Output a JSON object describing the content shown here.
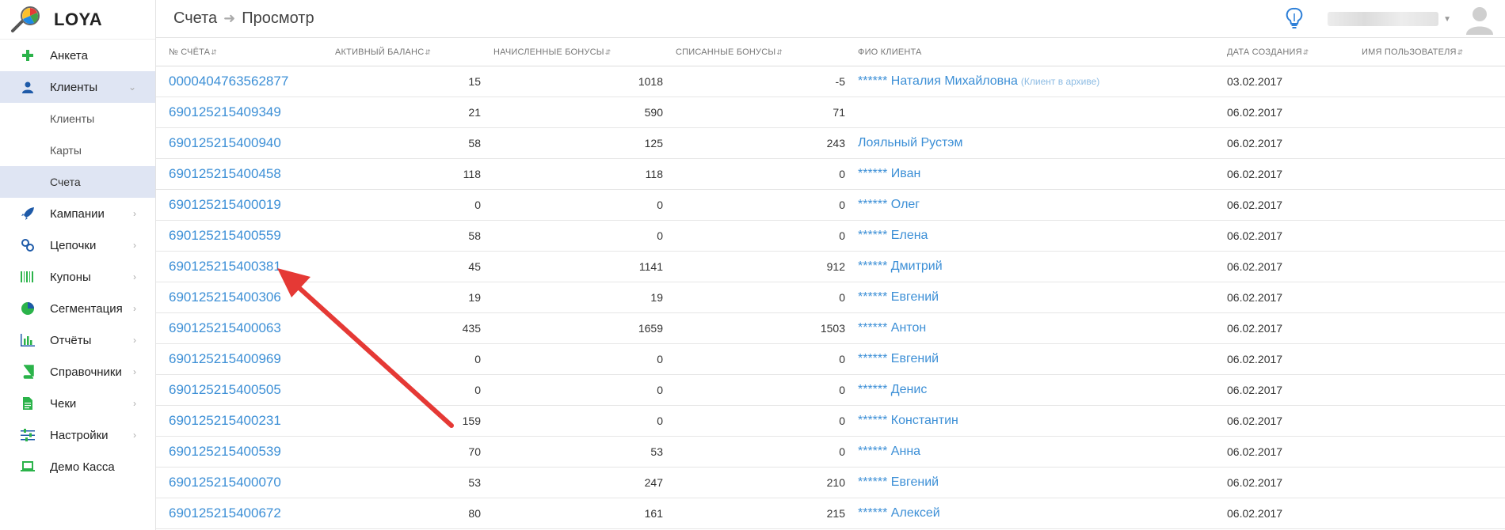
{
  "app": {
    "name": "LOYA"
  },
  "sidebar": {
    "items": [
      {
        "label": "Анкета",
        "icon": "plus-icon",
        "has_chevron": false
      },
      {
        "label": "Клиенты",
        "icon": "user-icon",
        "has_chevron": true,
        "expanded": true
      },
      {
        "label": "Клиенты",
        "sub": true
      },
      {
        "label": "Карты",
        "sub": true
      },
      {
        "label": "Счета",
        "sub": true,
        "active": true
      },
      {
        "label": "Кампании",
        "icon": "rocket-icon",
        "has_chevron": true
      },
      {
        "label": "Цепочки",
        "icon": "chain-icon",
        "has_chevron": true
      },
      {
        "label": "Купоны",
        "icon": "barcode-icon",
        "has_chevron": true
      },
      {
        "label": "Сегментация",
        "icon": "pie-chart-icon",
        "has_chevron": true
      },
      {
        "label": "Отчёты",
        "icon": "bar-chart-icon",
        "has_chevron": true
      },
      {
        "label": "Справочники",
        "icon": "book-icon",
        "has_chevron": true
      },
      {
        "label": "Чеки",
        "icon": "receipt-icon",
        "has_chevron": true
      },
      {
        "label": "Настройки",
        "icon": "sliders-icon",
        "has_chevron": true
      },
      {
        "label": "Демо Касса",
        "icon": "laptop-icon",
        "has_chevron": false
      }
    ]
  },
  "header": {
    "breadcrumb": [
      "Счета",
      "Просмотр"
    ]
  },
  "table": {
    "columns": [
      "№ СЧЁТА",
      "АКТИВНЫЙ БАЛАНС",
      "НАЧИСЛЕННЫЕ БОНУСЫ",
      "СПИСАННЫЕ БОНУСЫ",
      "ФИО КЛИЕНТА",
      "ДАТА СОЗДАНИЯ",
      "ИМЯ ПОЛЬЗОВАТЕЛЯ"
    ],
    "rows": [
      {
        "account": "0000404763562877",
        "balance": "15",
        "accrued": "1018",
        "spent": "-5",
        "fio": "****** Наталия Михайловна",
        "note": "(Клиент в архиве)",
        "date": "03.02.2017",
        "user": ""
      },
      {
        "account": "690125215409349",
        "balance": "21",
        "accrued": "590",
        "spent": "71",
        "fio": "",
        "note": "",
        "date": "06.02.2017",
        "user": ""
      },
      {
        "account": "690125215400940",
        "balance": "58",
        "accrued": "125",
        "spent": "243",
        "fio": "Лояльный Рустэм",
        "note": "",
        "date": "06.02.2017",
        "user": ""
      },
      {
        "account": "690125215400458",
        "balance": "118",
        "accrued": "118",
        "spent": "0",
        "fio": "****** Иван",
        "note": "",
        "date": "06.02.2017",
        "user": ""
      },
      {
        "account": "690125215400019",
        "balance": "0",
        "accrued": "0",
        "spent": "0",
        "fio": "****** Олег",
        "note": "",
        "date": "06.02.2017",
        "user": ""
      },
      {
        "account": "690125215400559",
        "balance": "58",
        "accrued": "0",
        "spent": "0",
        "fio": "****** Елена",
        "note": "",
        "date": "06.02.2017",
        "user": ""
      },
      {
        "account": "690125215400381",
        "balance": "45",
        "accrued": "1141",
        "spent": "912",
        "fio": "****** Дмитрий",
        "note": "",
        "date": "06.02.2017",
        "user": ""
      },
      {
        "account": "690125215400306",
        "balance": "19",
        "accrued": "19",
        "spent": "0",
        "fio": "****** Евгений",
        "note": "",
        "date": "06.02.2017",
        "user": ""
      },
      {
        "account": "690125215400063",
        "balance": "435",
        "accrued": "1659",
        "spent": "1503",
        "fio": "****** Антон",
        "note": "",
        "date": "06.02.2017",
        "user": ""
      },
      {
        "account": "690125215400969",
        "balance": "0",
        "accrued": "0",
        "spent": "0",
        "fio": "****** Евгений",
        "note": "",
        "date": "06.02.2017",
        "user": ""
      },
      {
        "account": "690125215400505",
        "balance": "0",
        "accrued": "0",
        "spent": "0",
        "fio": "****** Денис",
        "note": "",
        "date": "06.02.2017",
        "user": ""
      },
      {
        "account": "690125215400231",
        "balance": "159",
        "accrued": "0",
        "spent": "0",
        "fio": "****** Константин",
        "note": "",
        "date": "06.02.2017",
        "user": ""
      },
      {
        "account": "690125215400539",
        "balance": "70",
        "accrued": "53",
        "spent": "0",
        "fio": "****** Анна",
        "note": "",
        "date": "06.02.2017",
        "user": ""
      },
      {
        "account": "690125215400070",
        "balance": "53",
        "accrued": "247",
        "spent": "210",
        "fio": "****** Евгений",
        "note": "",
        "date": "06.02.2017",
        "user": ""
      },
      {
        "account": "690125215400672",
        "balance": "80",
        "accrued": "161",
        "spent": "215",
        "fio": "****** Алексей",
        "note": "",
        "date": "06.02.2017",
        "user": ""
      }
    ]
  },
  "annotation": {
    "color": "#e53935",
    "icon": "red-arrow-annotation"
  },
  "colors": {
    "link": "#3c8fd6",
    "active_nav": "#dfe5f3",
    "icon_green": "#2bb34a",
    "icon_blue": "#1e5aa8"
  }
}
